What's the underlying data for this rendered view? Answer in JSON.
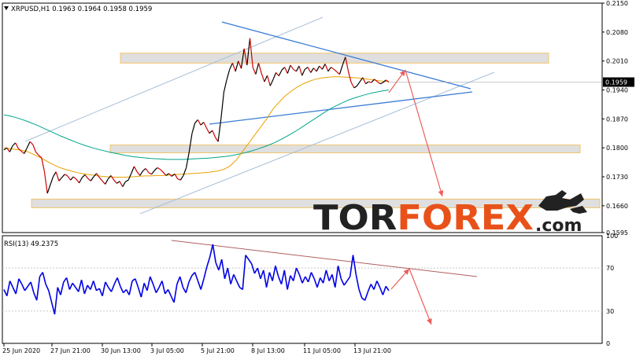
{
  "colors": {
    "background": "#ffffff",
    "price_line": "#d10000",
    "price_line_up": "#000000",
    "ma_fast": "#e8a300",
    "ma_slow": "#00a58a",
    "trend_line": "#3a7bd5",
    "channel_line": "#a8bfd8",
    "zone_fill": "#d9d9d9",
    "zone_border": "#f2c46b",
    "forecast_arrow": "#ee5c5c",
    "rsi_line": "#0000e6",
    "rsi_trend": "#b06060",
    "axis_text": "#000000",
    "current_price_bg": "#000000",
    "brand_dark": "#222222",
    "brand_accent": "#e8521a"
  },
  "header": {
    "symbol_caption": "XRPUSD,H1  0.1963 0.1964 0.1958 0.1959",
    "dropdown_icon": "triangle-down-icon"
  },
  "watermark": {
    "word_dark": "TOR",
    "word_accent": "FOREX",
    "suffix": ".com",
    "logo_icon": "bull-bear-icon"
  },
  "chart_data": [
    {
      "type": "line",
      "title": "XRPUSD,H1",
      "ohlc_caption": {
        "open": 0.1963,
        "high": 0.1964,
        "low": 0.1958,
        "close": 0.1959
      },
      "ylim": [
        0.1595,
        0.215
      ],
      "y_ticks": [
        "0.2150",
        "0.2080",
        "0.2010",
        "0.1940",
        "0.1870",
        "0.1800",
        "0.1730",
        "0.1660",
        "0.1595"
      ],
      "current_price": "0.1959",
      "x_ticks": [
        "25 Jun 2020",
        "27 Jun 21:00",
        "30 Jun 13:00",
        "3 Jul 05:00",
        "5 Jul 21:00",
        "8 Jul 13:00",
        "11 Jul 05:00",
        "13 Jul 21:00"
      ],
      "series": [
        {
          "values": [
            0.1795,
            0.18,
            0.179,
            0.1805,
            0.1812,
            0.1798,
            0.1792,
            0.1786,
            0.18,
            0.1815,
            0.1808,
            0.179,
            0.1782,
            0.1776,
            0.1742,
            0.169,
            0.171,
            0.173,
            0.1742,
            0.172,
            0.1728,
            0.1736,
            0.1732,
            0.1722,
            0.173,
            0.1724,
            0.1715,
            0.1728,
            0.1735,
            0.1726,
            0.172,
            0.173,
            0.1738,
            0.1728,
            0.172,
            0.1712,
            0.1725,
            0.1733,
            0.1722,
            0.1714,
            0.1719,
            0.1706,
            0.1718,
            0.1722,
            0.1738,
            0.1755,
            0.1742,
            0.1733,
            0.1744,
            0.175,
            0.174,
            0.1736,
            0.1745,
            0.1752,
            0.1748,
            0.1741,
            0.1733,
            0.1738,
            0.1731,
            0.1737,
            0.1725,
            0.1722,
            0.1733,
            0.1752,
            0.179,
            0.1835,
            0.186,
            0.1868,
            0.1855,
            0.1862,
            0.1848,
            0.1835,
            0.1842,
            0.1826,
            0.1815,
            0.187,
            0.1935,
            0.1965,
            0.199,
            0.2005,
            0.1985,
            0.201,
            0.1992,
            0.204,
            0.2,
            0.2065,
            0.1995,
            0.1978,
            0.2005,
            0.198,
            0.196,
            0.1975,
            0.195,
            0.1965,
            0.1982,
            0.1974,
            0.1988,
            0.1995,
            0.198,
            0.2,
            0.199,
            0.1985,
            0.1998,
            0.1975,
            0.199,
            0.1995,
            0.1982,
            0.1993,
            0.1985,
            0.1998,
            0.199,
            0.2003,
            0.1985,
            0.1995,
            0.199,
            0.1984,
            0.1978,
            0.2,
            0.202,
            0.1985,
            0.1958,
            0.1945,
            0.195,
            0.196,
            0.197,
            0.1955,
            0.196,
            0.1958,
            0.1966,
            0.196,
            0.1955,
            0.1958,
            0.1964,
            0.1959
          ]
        },
        {
          "name": "",
          "values": [
            0.18,
            0.1798,
            0.1796,
            0.1794,
            0.179,
            0.1783,
            0.1776,
            0.1768,
            0.176,
            0.1753,
            0.1748,
            0.1744,
            0.174,
            0.1737,
            0.1735,
            0.1733,
            0.1731,
            0.173,
            0.1729,
            0.1729,
            0.1729,
            0.173,
            0.1731,
            0.1732,
            0.1732,
            0.1733,
            0.1733,
            0.1734,
            0.1735,
            0.1736,
            0.1737,
            0.1738,
            0.1739,
            0.174,
            0.1742,
            0.1744,
            0.1748,
            0.1756,
            0.177,
            0.179,
            0.181,
            0.183,
            0.185,
            0.187,
            0.1893,
            0.191,
            0.1925,
            0.1937,
            0.1947,
            0.1955,
            0.1961,
            0.1966,
            0.1969,
            0.1971,
            0.1972,
            0.1972,
            0.1971,
            0.197,
            0.1969,
            0.1967,
            0.1965,
            0.1963,
            0.1961,
            0.196
          ]
        },
        {
          "name": "",
          "values": [
            0.188,
            0.1876,
            0.187,
            0.1863,
            0.1855,
            0.1846,
            0.1837,
            0.1828,
            0.182,
            0.1812,
            0.1805,
            0.1799,
            0.1794,
            0.1789,
            0.1785,
            0.1781,
            0.1778,
            0.1776,
            0.1774,
            0.1773,
            0.1772,
            0.1772,
            0.1772,
            0.1773,
            0.1774,
            0.1775,
            0.1777,
            0.1779,
            0.1782,
            0.1786,
            0.1791,
            0.1797,
            0.1804,
            0.1812,
            0.1822,
            0.1833,
            0.1845,
            0.1858,
            0.1871,
            0.1884,
            0.1896,
            0.1906,
            0.1915,
            0.1922,
            0.1928,
            0.1933,
            0.1937,
            0.194
          ]
        }
      ]
    },
    {
      "type": "line",
      "title": "RSI(13) 49.2375",
      "ylim": [
        0,
        100
      ],
      "y_ticks": [
        "100",
        "70",
        "30",
        "0"
      ],
      "series": [
        {
          "values": [
            50,
            44,
            58,
            52,
            46,
            60,
            55,
            49,
            53,
            57,
            47,
            40,
            62,
            66,
            55,
            49,
            38,
            27,
            52,
            45,
            57,
            61,
            50,
            56,
            52,
            48,
            59,
            46,
            54,
            50,
            58,
            49,
            51,
            44,
            57,
            52,
            48,
            55,
            61,
            53,
            47,
            50,
            45,
            58,
            60,
            52,
            43,
            56,
            49,
            62,
            55,
            47,
            52,
            58,
            46,
            50,
            44,
            38,
            55,
            62,
            52,
            47,
            57,
            63,
            66,
            58,
            50,
            60,
            71,
            80,
            92,
            75,
            68,
            78,
            60,
            70,
            55,
            64,
            58,
            52,
            50,
            82,
            78,
            74,
            65,
            70,
            60,
            68,
            52,
            66,
            58,
            72,
            62,
            55,
            68,
            50,
            63,
            58,
            70,
            64,
            56,
            62,
            57,
            66,
            60,
            52,
            61,
            56,
            68,
            58,
            64,
            52,
            72,
            60,
            54,
            58,
            62,
            82,
            64,
            50,
            42,
            40,
            48,
            55,
            50,
            58,
            52,
            45,
            53,
            49
          ]
        }
      ]
    }
  ]
}
